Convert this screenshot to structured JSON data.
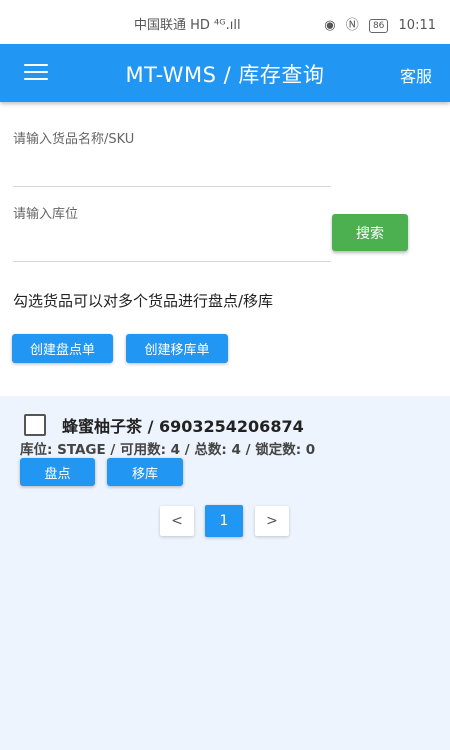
{
  "status_bar": {
    "carrier": "中国联通 HD ⁴ᴳ.ıll",
    "wifi_icon": "wifi-icon",
    "eye_icon": "eye-icon",
    "nfc_icon": "nfc-icon",
    "battery": "86",
    "time": "10:11"
  },
  "app_bar": {
    "menu_icon": "menu-icon",
    "title": "MT-WMS / 库存查询",
    "service_label": "客服",
    "color": "#2196f3"
  },
  "search": {
    "sku_label": "请输入货品名称/SKU",
    "sku_value": "",
    "location_label": "请输入库位",
    "location_value": "",
    "search_label": "搜索",
    "search_color": "#4caf50"
  },
  "actions": {
    "hint": "勾选货品可以对多个货品进行盘点/移库",
    "create_stocktake_label": "创建盘点单",
    "create_transfer_label": "创建移库单"
  },
  "items": [
    {
      "checked": false,
      "title": "蜂蜜柚子茶 / 6903254206874",
      "detail": "库位: STAGE / 可用数: 4 / 总数: 4 / 锁定数: 0",
      "stocktake_label": "盘点",
      "transfer_label": "移库"
    }
  ],
  "pagination": {
    "prev": "<",
    "current": "1",
    "next": ">"
  }
}
